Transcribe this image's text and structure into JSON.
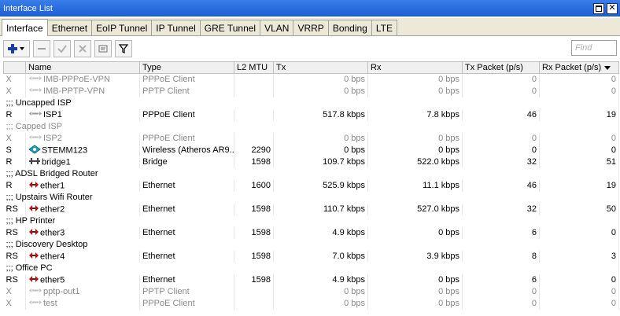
{
  "window": {
    "title": "Interface List"
  },
  "tabs": [
    "Interface",
    "Ethernet",
    "EoIP Tunnel",
    "IP Tunnel",
    "GRE Tunnel",
    "VLAN",
    "VRRP",
    "Bonding",
    "LTE"
  ],
  "toolbar": {
    "find_placeholder": "Find"
  },
  "columns": [
    "",
    "Name",
    "Type",
    "L2 MTU",
    "Tx",
    "Rx",
    "Tx Packet (p/s)",
    "Rx Packet (p/s)"
  ],
  "rows": [
    {
      "kind": "data",
      "flag": "X",
      "name": "IMB-PPPoE-VPN",
      "icon": "vpn-icon",
      "type": "PPPoE Client",
      "mtu": "",
      "tx": "0 bps",
      "rx": "0 bps",
      "txp": "0",
      "rxp": "0",
      "disabled": true
    },
    {
      "kind": "data",
      "flag": "X",
      "name": "IMB-PPTP-VPN",
      "icon": "vpn-icon",
      "type": "PPTP Client",
      "mtu": "",
      "tx": "0 bps",
      "rx": "0 bps",
      "txp": "0",
      "rxp": "0",
      "disabled": true
    },
    {
      "kind": "comment",
      "text": ";;; Uncapped ISP",
      "disabled": false
    },
    {
      "kind": "data",
      "flag": "R",
      "name": "ISP1",
      "icon": "vpn-icon",
      "type": "PPPoE Client",
      "mtu": "",
      "tx": "517.8 kbps",
      "rx": "7.8 kbps",
      "txp": "46",
      "rxp": "19",
      "disabled": false
    },
    {
      "kind": "comment",
      "text": ";;; Capped ISP",
      "disabled": true
    },
    {
      "kind": "data",
      "flag": "X",
      "name": "ISP2",
      "icon": "vpn-icon",
      "type": "PPPoE Client",
      "mtu": "",
      "tx": "0 bps",
      "rx": "0 bps",
      "txp": "0",
      "rxp": "0",
      "disabled": true
    },
    {
      "kind": "data",
      "flag": "S",
      "name": "STEMM123",
      "icon": "wireless-icon",
      "type": "Wireless (Atheros AR9...",
      "mtu": "2290",
      "tx": "0 bps",
      "rx": "0 bps",
      "txp": "0",
      "rxp": "0",
      "disabled": false
    },
    {
      "kind": "data",
      "flag": "R",
      "name": "bridge1",
      "icon": "bridge-icon",
      "type": "Bridge",
      "mtu": "1598",
      "tx": "109.7 kbps",
      "rx": "522.0 kbps",
      "txp": "32",
      "rxp": "51",
      "disabled": false
    },
    {
      "kind": "comment",
      "text": ";;; ADSL Bridged Router",
      "disabled": false
    },
    {
      "kind": "data",
      "flag": "R",
      "name": "ether1",
      "icon": "ethernet-icon",
      "type": "Ethernet",
      "mtu": "1600",
      "tx": "525.9 kbps",
      "rx": "11.1 kbps",
      "txp": "46",
      "rxp": "19",
      "disabled": false
    },
    {
      "kind": "comment",
      "text": ";;; Upstairs Wifi Router",
      "disabled": false
    },
    {
      "kind": "data",
      "flag": "RS",
      "name": "ether2",
      "icon": "ethernet-icon",
      "type": "Ethernet",
      "mtu": "1598",
      "tx": "110.7 kbps",
      "rx": "527.0 kbps",
      "txp": "32",
      "rxp": "50",
      "disabled": false
    },
    {
      "kind": "comment",
      "text": ";;; HP Printer",
      "disabled": false
    },
    {
      "kind": "data",
      "flag": "RS",
      "name": "ether3",
      "icon": "ethernet-icon",
      "type": "Ethernet",
      "mtu": "1598",
      "tx": "4.9 kbps",
      "rx": "0 bps",
      "txp": "6",
      "rxp": "0",
      "disabled": false
    },
    {
      "kind": "comment",
      "text": ";;; Discovery Desktop",
      "disabled": false
    },
    {
      "kind": "data",
      "flag": "RS",
      "name": "ether4",
      "icon": "ethernet-icon",
      "type": "Ethernet",
      "mtu": "1598",
      "tx": "7.0 kbps",
      "rx": "3.9 kbps",
      "txp": "8",
      "rxp": "3",
      "disabled": false
    },
    {
      "kind": "comment",
      "text": ";;; Office PC",
      "disabled": false
    },
    {
      "kind": "data",
      "flag": "RS",
      "name": "ether5",
      "icon": "ethernet-icon",
      "type": "Ethernet",
      "mtu": "1598",
      "tx": "4.9 kbps",
      "rx": "0 bps",
      "txp": "6",
      "rxp": "0",
      "disabled": false
    },
    {
      "kind": "data",
      "flag": "X",
      "name": "pptp-out1",
      "icon": "vpn-icon",
      "type": "PPTP Client",
      "mtu": "",
      "tx": "0 bps",
      "rx": "0 bps",
      "txp": "0",
      "rxp": "0",
      "disabled": true
    },
    {
      "kind": "data",
      "flag": "X",
      "name": "test",
      "icon": "vpn-icon",
      "type": "PPPoE Client",
      "mtu": "",
      "tx": "0 bps",
      "rx": "0 bps",
      "txp": "0",
      "rxp": "0",
      "disabled": true
    }
  ],
  "colors": {
    "title_bar": "#1c5ed6",
    "ethernet_icon": "#cc0000",
    "wireless_icon": "#20a0c0",
    "disabled_text": "#8a8a8a"
  }
}
